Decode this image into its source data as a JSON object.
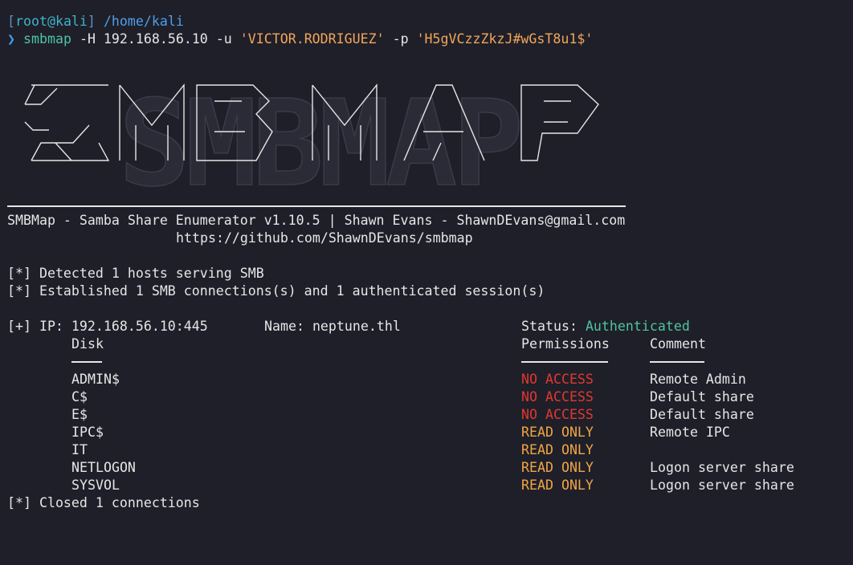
{
  "prompt": {
    "user": "root@kali",
    "path": "/home/kali",
    "arrow": "❯",
    "command": "smbmap",
    "args": [
      {
        "text": "-H 192.168.56.10 -u ",
        "kind": "flag"
      },
      {
        "text": "'VICTOR.RODRIGUEZ'",
        "kind": "str"
      },
      {
        "text": " -p ",
        "kind": "flag"
      },
      {
        "text": "'H5gVCzzZkzJ#wGsT8u1$'",
        "kind": "str"
      }
    ]
  },
  "banner": {
    "logo_text": "SMBMAP",
    "tagline": "SMBMap - Samba Share Enumerator v1.10.5 | Shawn Evans - ShawnDEvans@gmail.com",
    "url": "https://github.com/ShawnDEvans/smbmap"
  },
  "status_lines": [
    "[*] Detected 1 hosts serving SMB",
    "[*] Established 1 SMB connections(s) and 1 authenticated session(s)"
  ],
  "host": {
    "prefix": "[+] IP: 192.168.56.10:445",
    "name": "Name: neptune.thl",
    "status_label": "Status: ",
    "status_value": "Authenticated"
  },
  "headers": {
    "disk": "Disk",
    "permissions": "Permissions",
    "comment": "Comment"
  },
  "shares": [
    {
      "disk": "ADMIN$",
      "perm": "NO ACCESS",
      "comment": "Remote Admin"
    },
    {
      "disk": "C$",
      "perm": "NO ACCESS",
      "comment": "Default share"
    },
    {
      "disk": "E$",
      "perm": "NO ACCESS",
      "comment": "Default share"
    },
    {
      "disk": "IPC$",
      "perm": "READ ONLY",
      "comment": "Remote IPC"
    },
    {
      "disk": "IT",
      "perm": "READ ONLY",
      "comment": ""
    },
    {
      "disk": "NETLOGON",
      "perm": "READ ONLY",
      "comment": "Logon server share"
    },
    {
      "disk": "SYSVOL",
      "perm": "READ ONLY",
      "comment": "Logon server share"
    }
  ],
  "closing": "[*] Closed 1 connections",
  "colors": {
    "background": "#1e1f29",
    "authenticated": "#4fc3a1",
    "no_access": "#e0382f",
    "read_only": "#f2a545",
    "string_arg": "#f2a65a",
    "command": "#4ec2a5"
  }
}
